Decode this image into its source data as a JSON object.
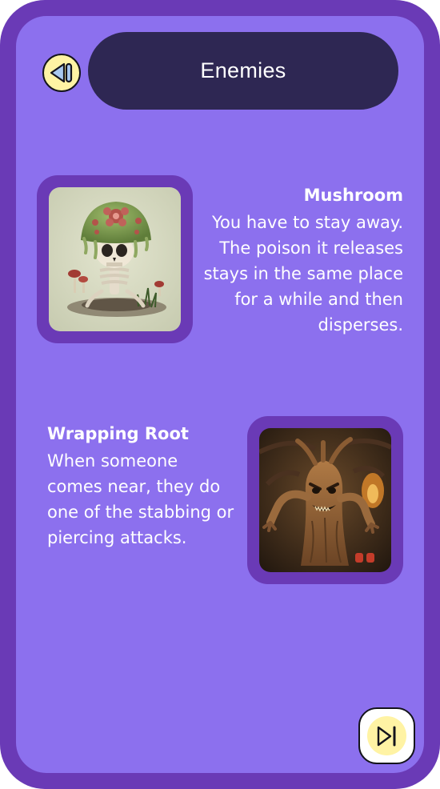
{
  "header": {
    "title": "Enemies",
    "back_icon": "rewind-icon"
  },
  "enemies": [
    {
      "name": "Mushroom",
      "description": "You have to stay away. The poison it releases stays in the same place for a while and then disperses.",
      "image": "mushroom-creature-image"
    },
    {
      "name": "Wrapping Root",
      "description": "When someone comes near, they do one of the stabbing or piercing attacks.",
      "image": "tree-root-creature-image"
    }
  ],
  "footer": {
    "next_icon": "skip-forward-icon"
  },
  "colors": {
    "outer_frame": "#6a3ab6",
    "panel": "#8c70ee",
    "title_pill": "#2e2753",
    "button_yellow": "#fff3a4",
    "text": "#ffffff"
  }
}
